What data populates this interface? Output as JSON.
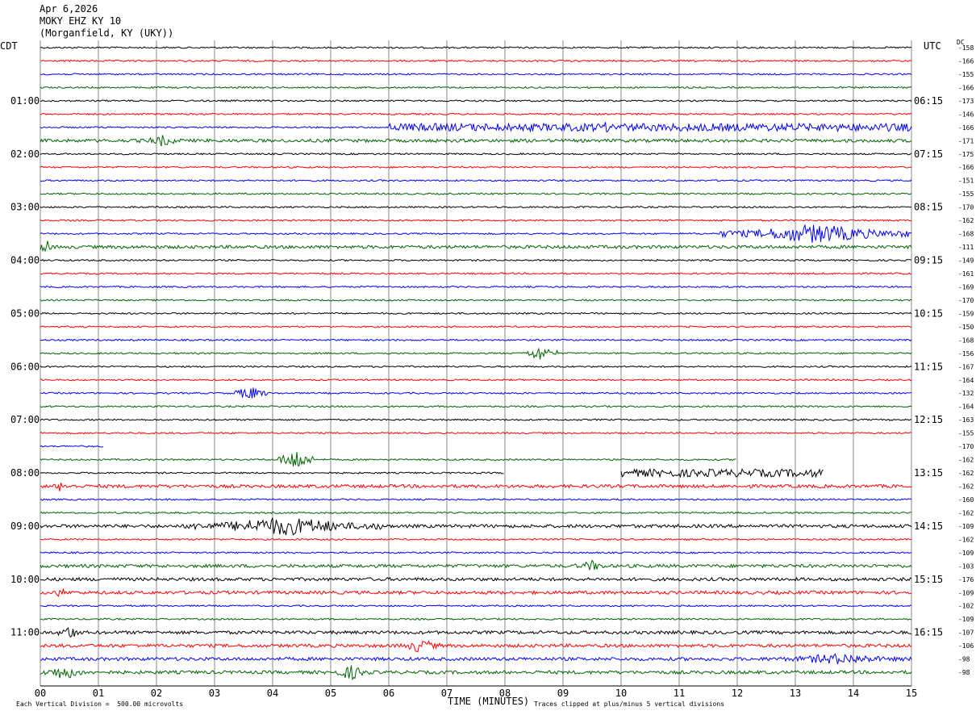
{
  "header": {
    "date": "Apr 6,2026",
    "station": "MOKY EHZ KY 10",
    "location": "(Morganfield, KY (UKY))"
  },
  "left_axis_title": "CDT",
  "right_axis_title": "UTC",
  "dc_title": "DC",
  "x_axis_title": "TIME (MINUTES)",
  "footer": {
    "scale_note": "Each Vertical Division =  500.00 microvolts",
    "clip_note": "Traces clipped at plus/minus 5 vertical divisions"
  },
  "colors": {
    "cycle": [
      "#000000",
      "#ff0000",
      "#0000ff",
      "#006400"
    ],
    "grid": "#888888"
  },
  "chart_data": {
    "type": "line",
    "title": "MOKY EHZ KY 10",
    "xlabel": "TIME (MINUTES)",
    "xlim": [
      0,
      15
    ],
    "x_ticks": [
      "00",
      "01",
      "02",
      "03",
      "04",
      "05",
      "06",
      "07",
      "08",
      "09",
      "10",
      "11",
      "12",
      "13",
      "14",
      "15"
    ],
    "left_hour_labels": [
      "01:00",
      "02:00",
      "03:00",
      "04:00",
      "05:00",
      "06:00",
      "07:00",
      "08:00",
      "09:00",
      "10:00",
      "11:00"
    ],
    "right_hour_labels": [
      "06:15",
      "07:15",
      "08:15",
      "09:15",
      "10:15",
      "11:15",
      "12:15",
      "13:15",
      "14:15",
      "15:15",
      "16:15"
    ],
    "hour_label_trace_index": [
      4,
      8,
      12,
      16,
      20,
      24,
      28,
      32,
      36,
      40,
      44
    ],
    "dc_offsets": [
      "-158",
      "-166",
      "-155",
      "-166",
      "-173",
      "-146",
      "-166",
      "-171",
      "-175",
      "-166",
      "-151",
      "-155",
      "-170",
      "-162",
      "-168",
      "-111",
      "-149",
      "-161",
      "-169",
      "-170",
      "-159",
      "-150",
      "-168",
      "-156",
      "-167",
      "-164",
      "-132",
      "-164",
      "-163",
      "-155",
      "-170",
      "-162",
      "-162",
      "-162",
      "-160",
      "-162",
      "-109",
      "-162",
      "-109",
      "-103",
      "-176",
      "-109",
      "-102",
      "-109",
      "-107",
      "-106",
      "-98",
      "-98"
    ],
    "trace_amplitude_level": [
      1,
      1,
      1,
      1,
      1,
      1,
      1,
      2,
      1,
      1,
      1,
      1,
      1,
      1,
      1,
      2,
      1,
      1,
      1,
      1,
      1,
      1,
      1,
      1,
      1,
      1,
      1,
      1,
      1,
      1,
      1,
      1,
      1,
      2,
      1,
      1,
      2,
      1,
      1,
      2,
      2,
      2,
      1,
      1,
      2,
      2,
      2,
      2
    ],
    "events": [
      {
        "trace": 6,
        "start_min": 6.0,
        "end_min": 15.0,
        "level": 2
      },
      {
        "trace": 6,
        "start_min": 9.4,
        "end_min": 10.0,
        "level": 3
      },
      {
        "trace": 7,
        "start_min": 1.7,
        "end_min": 2.5,
        "level": 3
      },
      {
        "trace": 14,
        "start_min": 11.7,
        "end_min": 15.0,
        "level": 5
      },
      {
        "trace": 15,
        "start_min": 0.0,
        "end_min": 0.2,
        "level": 5
      },
      {
        "trace": 23,
        "start_min": 8.3,
        "end_min": 8.9,
        "level": 4
      },
      {
        "trace": 26,
        "start_min": 3.3,
        "end_min": 3.9,
        "level": 4
      },
      {
        "trace": 31,
        "start_min": 4.1,
        "end_min": 4.7,
        "level": 6
      },
      {
        "trace": 32,
        "start_min": 10.0,
        "end_min": 13.5,
        "level": 2
      },
      {
        "trace": 33,
        "start_min": 0.2,
        "end_min": 0.5,
        "level": 3
      },
      {
        "trace": 36,
        "start_min": 2.5,
        "end_min": 5.9,
        "level": 5
      },
      {
        "trace": 39,
        "start_min": 9.2,
        "end_min": 9.8,
        "level": 3
      },
      {
        "trace": 41,
        "start_min": 0.2,
        "end_min": 0.5,
        "level": 3
      },
      {
        "trace": 44,
        "start_min": 0.3,
        "end_min": 0.7,
        "level": 4
      },
      {
        "trace": 45,
        "start_min": 6.2,
        "end_min": 6.9,
        "level": 4
      },
      {
        "trace": 46,
        "start_min": 12.5,
        "end_min": 15.0,
        "level": 3
      },
      {
        "trace": 47,
        "start_min": 0.0,
        "end_min": 0.8,
        "level": 4
      },
      {
        "trace": 47,
        "start_min": 5.0,
        "end_min": 5.7,
        "level": 4
      }
    ],
    "gaps": [
      {
        "trace": 30,
        "start_min": 1.1,
        "end_min": 15.0
      },
      {
        "trace": 31,
        "start_min": 12.0,
        "end_min": 15.0
      },
      {
        "trace": 32,
        "start_min": 8.0,
        "end_min": 10.0
      },
      {
        "trace": 32,
        "start_min": 13.5,
        "end_min": 15.0
      }
    ]
  }
}
